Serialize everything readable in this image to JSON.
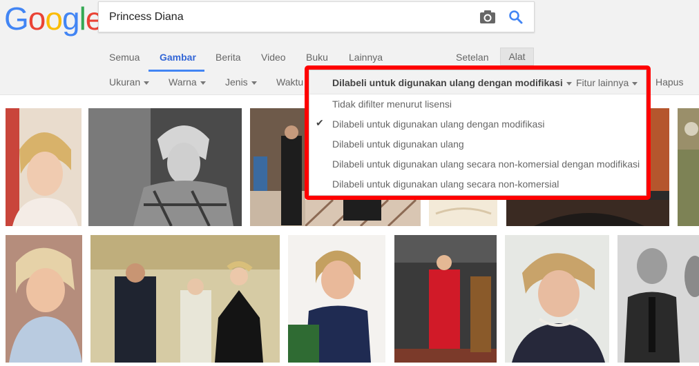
{
  "logo": {
    "letters": [
      "G",
      "o",
      "o",
      "g",
      "l",
      "e"
    ],
    "colors": [
      "#4285f4",
      "#ea4335",
      "#fbbc05",
      "#4285f4",
      "#34a853",
      "#ea4335"
    ]
  },
  "search": {
    "value": "Princess Diana"
  },
  "tabs": [
    {
      "label": "Semua"
    },
    {
      "label": "Gambar"
    },
    {
      "label": "Berita"
    },
    {
      "label": "Video"
    },
    {
      "label": "Buku"
    },
    {
      "label": "Lainnya"
    }
  ],
  "setelan": "Setelan",
  "alat": "Alat",
  "filters": {
    "ukuran": "Ukuran",
    "warna": "Warna",
    "jenis": "Jenis",
    "waktu": "Waktu",
    "hapus": "Hapus"
  },
  "dropdown": {
    "selected": "Dilabeli untuk digunakan ulang dengan modifikasi",
    "more": "Fitur lainnya",
    "items": [
      "Tidak difilter menurut lisensi",
      "Dilabeli untuk digunakan ulang dengan modifikasi",
      "Dilabeli untuk digunakan ulang",
      "Dilabeli untuk digunakan ulang secara non-komersial dengan modifikasi",
      "Dilabeli untuk digunakan ulang secara non-komersial"
    ],
    "checked_index": 1
  },
  "icons": {
    "camera": "camera-icon",
    "search": "search-icon",
    "check": "check-icon",
    "caret": "caret-down-icon"
  },
  "accent": "#4285f4",
  "highlight_color": "#ff0000"
}
